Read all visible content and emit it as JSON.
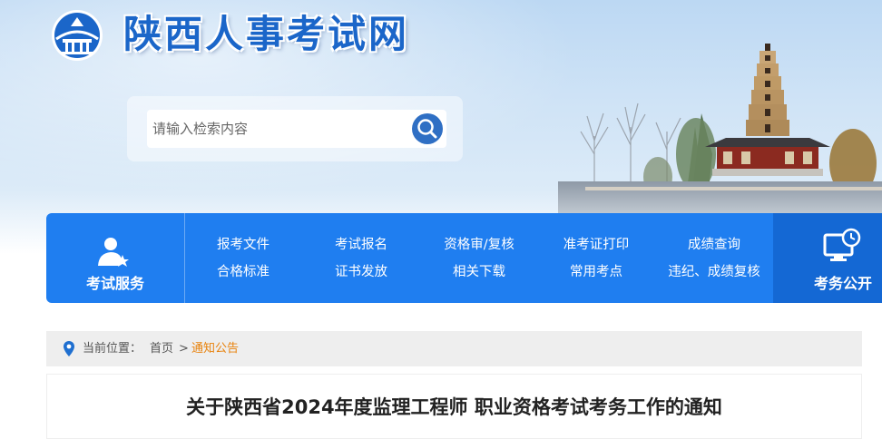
{
  "site": {
    "title": "陕西人事考试网"
  },
  "search": {
    "placeholder": "请输入检索内容"
  },
  "nav": {
    "left_label": "考试服务",
    "right_label": "考务公开",
    "items": [
      {
        "top": "报考文件",
        "bottom": "合格标准"
      },
      {
        "top": "考试报名",
        "bottom": "证书发放"
      },
      {
        "top": "资格审/复核",
        "bottom": "相关下载"
      },
      {
        "top": "准考证打印",
        "bottom": "常用考点"
      },
      {
        "top": "成绩查询",
        "bottom": "违纪、成绩复核"
      }
    ]
  },
  "breadcrumb": {
    "prefix": "当前位置：",
    "home": "首页",
    "separator": ">",
    "current": "通知公告"
  },
  "article": {
    "title": "关于陕西省2024年度监理工程师 职业资格考试考务工作的通知"
  },
  "colors": {
    "primary": "#1f7ef0",
    "nav_right": "#1468d4",
    "breadcrumb_current": "#e8820c",
    "title_blue": "#1b66c9"
  }
}
